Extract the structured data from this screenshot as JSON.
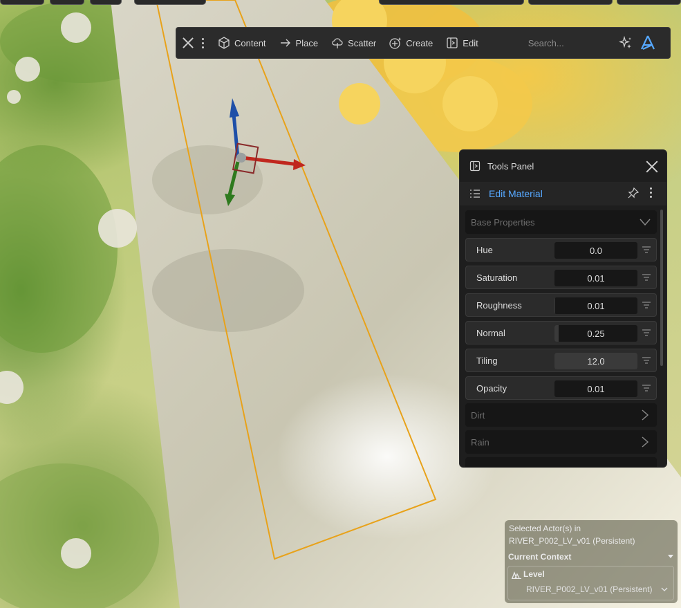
{
  "toolbar": {
    "items": [
      {
        "label": "Content",
        "icon": "cube-icon"
      },
      {
        "label": "Place",
        "icon": "arrow-right-icon"
      },
      {
        "label": "Scatter",
        "icon": "tree-icon"
      },
      {
        "label": "Create",
        "icon": "add-sparkle-icon"
      },
      {
        "label": "Edit",
        "icon": "edit-panel-icon"
      }
    ],
    "search_placeholder": "Search..."
  },
  "panel": {
    "title": "Tools Panel",
    "subtitle": "Edit Material",
    "sections": {
      "base": "Base Properties",
      "dirt": "Dirt",
      "rain": "Rain"
    },
    "properties": [
      {
        "label": "Hue",
        "value": "0.0",
        "fill": 0
      },
      {
        "label": "Saturation",
        "value": "0.01",
        "fill": 0
      },
      {
        "label": "Roughness",
        "value": "0.01",
        "fill": 0.01
      },
      {
        "label": "Normal",
        "value": "0.25",
        "fill": 0.05
      },
      {
        "label": "Tiling",
        "value": "12.0",
        "fill": 1
      },
      {
        "label": "Opacity",
        "value": "0.01",
        "fill": 0
      }
    ]
  },
  "context": {
    "selected_line1": "Selected Actor(s) in",
    "selected_line2": "RIVER_P002_LV_v01 (Persistent)",
    "current_context": "Current Context",
    "level_label": "Level",
    "level_value": "RIVER_P002_LV_v01 (Persistent)"
  },
  "colors": {
    "accent": "#56a8ff",
    "selection": "#e8a21a",
    "gizmo_x": "#c0271e",
    "gizmo_y": "#2e7a1e",
    "gizmo_z": "#1e4fa8"
  }
}
